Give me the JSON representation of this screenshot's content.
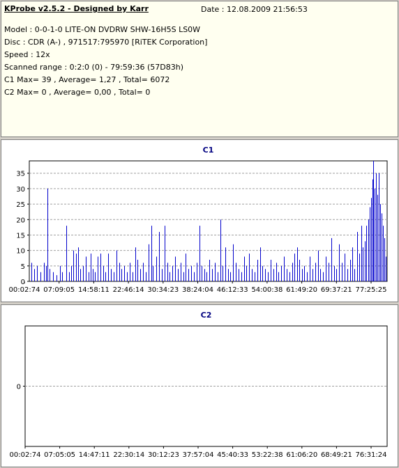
{
  "header": {
    "title": "KProbe v2.5.2 - Designed by Karr",
    "date": "Date : 12.08.2009 21:56:53",
    "lines": [
      "Model : 0-0-1-0 LITE-ON DVDRW SHW-16H5S  LS0W",
      "Disc : CDR (A-) , 971517:795970 [RiTEK Corporation]",
      "Speed : 12x",
      "Scanned range : 0:2:0 (0) - 79:59:36 (57D83h)",
      "C1 Max= 39 , Average= 1,27 , Total= 6072",
      "C2 Max= 0 , Average= 0,00 , Total= 0"
    ]
  },
  "colors": {
    "series": "#0000cc",
    "grid": "#a0a0a0",
    "title": "#000080"
  },
  "chart_data": [
    {
      "type": "bar",
      "title": "C1",
      "x_tick_labels": [
        "00:02:74",
        "07:09:05",
        "14:58:11",
        "22:46:14",
        "30:34:23",
        "38:24:04",
        "46:12:33",
        "54:00:38",
        "61:49:20",
        "69:37:21",
        "77:25:25"
      ],
      "y_ticks": [
        0,
        5,
        10,
        15,
        20,
        25,
        30,
        35
      ],
      "ylim": [
        0,
        39
      ],
      "grid": "dashed horizontal",
      "x_range_minutes": [
        0.03,
        80.0
      ],
      "spikes": [
        [
          0.3,
          6
        ],
        [
          0.9,
          4
        ],
        [
          1.6,
          5
        ],
        [
          2.4,
          3
        ],
        [
          3.1,
          6
        ],
        [
          3.6,
          5
        ],
        [
          4.0,
          30
        ],
        [
          4.4,
          4
        ],
        [
          5.2,
          3
        ],
        [
          6.0,
          2
        ],
        [
          6.8,
          5
        ],
        [
          7.2,
          3
        ],
        [
          8.1,
          18
        ],
        [
          8.8,
          3
        ],
        [
          9.3,
          5
        ],
        [
          9.8,
          10
        ],
        [
          10.3,
          9
        ],
        [
          10.8,
          11
        ],
        [
          11.3,
          4
        ],
        [
          11.9,
          5
        ],
        [
          12.5,
          8
        ],
        [
          13.1,
          3
        ],
        [
          13.6,
          9
        ],
        [
          14.1,
          4
        ],
        [
          14.6,
          3
        ],
        [
          15.2,
          8
        ],
        [
          15.8,
          9
        ],
        [
          16.4,
          5
        ],
        [
          17.0,
          3
        ],
        [
          17.6,
          9
        ],
        [
          18.2,
          4
        ],
        [
          18.8,
          3
        ],
        [
          19.4,
          10
        ],
        [
          20.0,
          6
        ],
        [
          20.6,
          4
        ],
        [
          21.2,
          5
        ],
        [
          21.8,
          3
        ],
        [
          22.4,
          6
        ],
        [
          23.0,
          3
        ],
        [
          23.6,
          11
        ],
        [
          24.2,
          7
        ],
        [
          24.8,
          4
        ],
        [
          25.4,
          6
        ],
        [
          26.0,
          3
        ],
        [
          26.6,
          12
        ],
        [
          27.2,
          18
        ],
        [
          27.6,
          5
        ],
        [
          28.4,
          8
        ],
        [
          29.0,
          16
        ],
        [
          29.6,
          4
        ],
        [
          30.2,
          18
        ],
        [
          30.8,
          6
        ],
        [
          31.4,
          3
        ],
        [
          32.0,
          5
        ],
        [
          32.6,
          8
        ],
        [
          33.2,
          4
        ],
        [
          33.8,
          6
        ],
        [
          34.4,
          3
        ],
        [
          35.0,
          9
        ],
        [
          35.5,
          4
        ],
        [
          36.2,
          5
        ],
        [
          36.8,
          3
        ],
        [
          37.4,
          6
        ],
        [
          38.0,
          18
        ],
        [
          38.5,
          5
        ],
        [
          39.1,
          4
        ],
        [
          39.7,
          3
        ],
        [
          40.3,
          7
        ],
        [
          40.9,
          4
        ],
        [
          41.5,
          6
        ],
        [
          42.1,
          3
        ],
        [
          42.7,
          20
        ],
        [
          43.2,
          5
        ],
        [
          43.8,
          11
        ],
        [
          44.4,
          4
        ],
        [
          45.0,
          3
        ],
        [
          45.6,
          12
        ],
        [
          46.2,
          6
        ],
        [
          46.8,
          4
        ],
        [
          47.4,
          3
        ],
        [
          48.0,
          8
        ],
        [
          48.6,
          5
        ],
        [
          49.2,
          9
        ],
        [
          49.8,
          4
        ],
        [
          50.4,
          3
        ],
        [
          51.0,
          7
        ],
        [
          51.6,
          11
        ],
        [
          52.2,
          5
        ],
        [
          52.8,
          4
        ],
        [
          53.4,
          3
        ],
        [
          54.0,
          7
        ],
        [
          54.6,
          4
        ],
        [
          55.2,
          6
        ],
        [
          55.8,
          3
        ],
        [
          56.4,
          5
        ],
        [
          57.0,
          8
        ],
        [
          57.6,
          4
        ],
        [
          58.2,
          3
        ],
        [
          58.8,
          6
        ],
        [
          59.4,
          9
        ],
        [
          60.0,
          11
        ],
        [
          60.5,
          7
        ],
        [
          61.0,
          4
        ],
        [
          61.6,
          5
        ],
        [
          62.2,
          3
        ],
        [
          62.8,
          8
        ],
        [
          63.4,
          4
        ],
        [
          64.0,
          6
        ],
        [
          64.6,
          10
        ],
        [
          65.2,
          4
        ],
        [
          65.8,
          3
        ],
        [
          66.4,
          8
        ],
        [
          67.0,
          6
        ],
        [
          67.6,
          14
        ],
        [
          68.2,
          5
        ],
        [
          68.8,
          4
        ],
        [
          69.4,
          12
        ],
        [
          70.0,
          6
        ],
        [
          70.6,
          9
        ],
        [
          71.2,
          4
        ],
        [
          71.8,
          7
        ],
        [
          72.4,
          11
        ],
        [
          72.8,
          4
        ],
        [
          73.4,
          16
        ],
        [
          73.9,
          9
        ],
        [
          74.3,
          18
        ],
        [
          74.7,
          11
        ],
        [
          75.1,
          13
        ],
        [
          75.5,
          18
        ],
        [
          75.9,
          20
        ],
        [
          76.2,
          24
        ],
        [
          76.5,
          27
        ],
        [
          76.8,
          33
        ],
        [
          77.1,
          39
        ],
        [
          77.4,
          30
        ],
        [
          77.7,
          35
        ],
        [
          78.0,
          28
        ],
        [
          78.3,
          35
        ],
        [
          78.6,
          25
        ],
        [
          78.9,
          22
        ],
        [
          79.2,
          18
        ],
        [
          79.5,
          14
        ],
        [
          79.8,
          8
        ]
      ]
    },
    {
      "type": "bar",
      "title": "C2",
      "x_tick_labels": [
        "00:02:74",
        "07:05:05",
        "14:47:11",
        "22:30:14",
        "30:12:23",
        "37:57:04",
        "45:40:33",
        "53:22:38",
        "61:06:20",
        "68:49:21",
        "76:31:24"
      ],
      "y_ticks": [
        0
      ],
      "ylim": [
        -1,
        1
      ],
      "grid": "dashed horizontal",
      "values": []
    }
  ]
}
